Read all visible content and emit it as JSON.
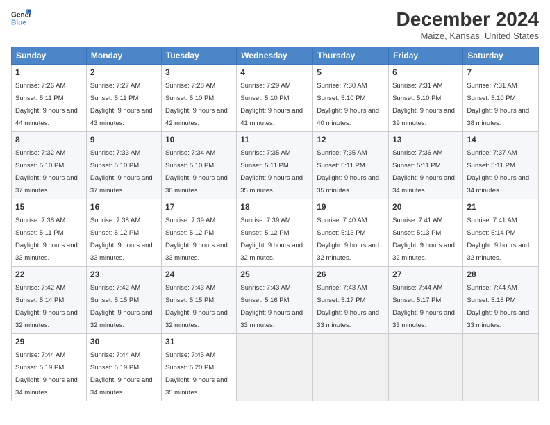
{
  "header": {
    "logo_line1": "General",
    "logo_line2": "Blue",
    "month": "December 2024",
    "location": "Maize, Kansas, United States"
  },
  "weekdays": [
    "Sunday",
    "Monday",
    "Tuesday",
    "Wednesday",
    "Thursday",
    "Friday",
    "Saturday"
  ],
  "weeks": [
    [
      {
        "day": "1",
        "sunrise": "Sunrise: 7:26 AM",
        "sunset": "Sunset: 5:11 PM",
        "daylight": "Daylight: 9 hours and 44 minutes."
      },
      {
        "day": "2",
        "sunrise": "Sunrise: 7:27 AM",
        "sunset": "Sunset: 5:11 PM",
        "daylight": "Daylight: 9 hours and 43 minutes."
      },
      {
        "day": "3",
        "sunrise": "Sunrise: 7:28 AM",
        "sunset": "Sunset: 5:10 PM",
        "daylight": "Daylight: 9 hours and 42 minutes."
      },
      {
        "day": "4",
        "sunrise": "Sunrise: 7:29 AM",
        "sunset": "Sunset: 5:10 PM",
        "daylight": "Daylight: 9 hours and 41 minutes."
      },
      {
        "day": "5",
        "sunrise": "Sunrise: 7:30 AM",
        "sunset": "Sunset: 5:10 PM",
        "daylight": "Daylight: 9 hours and 40 minutes."
      },
      {
        "day": "6",
        "sunrise": "Sunrise: 7:31 AM",
        "sunset": "Sunset: 5:10 PM",
        "daylight": "Daylight: 9 hours and 39 minutes."
      },
      {
        "day": "7",
        "sunrise": "Sunrise: 7:31 AM",
        "sunset": "Sunset: 5:10 PM",
        "daylight": "Daylight: 9 hours and 38 minutes."
      }
    ],
    [
      {
        "day": "8",
        "sunrise": "Sunrise: 7:32 AM",
        "sunset": "Sunset: 5:10 PM",
        "daylight": "Daylight: 9 hours and 37 minutes."
      },
      {
        "day": "9",
        "sunrise": "Sunrise: 7:33 AM",
        "sunset": "Sunset: 5:10 PM",
        "daylight": "Daylight: 9 hours and 37 minutes."
      },
      {
        "day": "10",
        "sunrise": "Sunrise: 7:34 AM",
        "sunset": "Sunset: 5:10 PM",
        "daylight": "Daylight: 9 hours and 36 minutes."
      },
      {
        "day": "11",
        "sunrise": "Sunrise: 7:35 AM",
        "sunset": "Sunset: 5:11 PM",
        "daylight": "Daylight: 9 hours and 35 minutes."
      },
      {
        "day": "12",
        "sunrise": "Sunrise: 7:35 AM",
        "sunset": "Sunset: 5:11 PM",
        "daylight": "Daylight: 9 hours and 35 minutes."
      },
      {
        "day": "13",
        "sunrise": "Sunrise: 7:36 AM",
        "sunset": "Sunset: 5:11 PM",
        "daylight": "Daylight: 9 hours and 34 minutes."
      },
      {
        "day": "14",
        "sunrise": "Sunrise: 7:37 AM",
        "sunset": "Sunset: 5:11 PM",
        "daylight": "Daylight: 9 hours and 34 minutes."
      }
    ],
    [
      {
        "day": "15",
        "sunrise": "Sunrise: 7:38 AM",
        "sunset": "Sunset: 5:11 PM",
        "daylight": "Daylight: 9 hours and 33 minutes."
      },
      {
        "day": "16",
        "sunrise": "Sunrise: 7:38 AM",
        "sunset": "Sunset: 5:12 PM",
        "daylight": "Daylight: 9 hours and 33 minutes."
      },
      {
        "day": "17",
        "sunrise": "Sunrise: 7:39 AM",
        "sunset": "Sunset: 5:12 PM",
        "daylight": "Daylight: 9 hours and 33 minutes."
      },
      {
        "day": "18",
        "sunrise": "Sunrise: 7:39 AM",
        "sunset": "Sunset: 5:12 PM",
        "daylight": "Daylight: 9 hours and 32 minutes."
      },
      {
        "day": "19",
        "sunrise": "Sunrise: 7:40 AM",
        "sunset": "Sunset: 5:13 PM",
        "daylight": "Daylight: 9 hours and 32 minutes."
      },
      {
        "day": "20",
        "sunrise": "Sunrise: 7:41 AM",
        "sunset": "Sunset: 5:13 PM",
        "daylight": "Daylight: 9 hours and 32 minutes."
      },
      {
        "day": "21",
        "sunrise": "Sunrise: 7:41 AM",
        "sunset": "Sunset: 5:14 PM",
        "daylight": "Daylight: 9 hours and 32 minutes."
      }
    ],
    [
      {
        "day": "22",
        "sunrise": "Sunrise: 7:42 AM",
        "sunset": "Sunset: 5:14 PM",
        "daylight": "Daylight: 9 hours and 32 minutes."
      },
      {
        "day": "23",
        "sunrise": "Sunrise: 7:42 AM",
        "sunset": "Sunset: 5:15 PM",
        "daylight": "Daylight: 9 hours and 32 minutes."
      },
      {
        "day": "24",
        "sunrise": "Sunrise: 7:43 AM",
        "sunset": "Sunset: 5:15 PM",
        "daylight": "Daylight: 9 hours and 32 minutes."
      },
      {
        "day": "25",
        "sunrise": "Sunrise: 7:43 AM",
        "sunset": "Sunset: 5:16 PM",
        "daylight": "Daylight: 9 hours and 33 minutes."
      },
      {
        "day": "26",
        "sunrise": "Sunrise: 7:43 AM",
        "sunset": "Sunset: 5:17 PM",
        "daylight": "Daylight: 9 hours and 33 minutes."
      },
      {
        "day": "27",
        "sunrise": "Sunrise: 7:44 AM",
        "sunset": "Sunset: 5:17 PM",
        "daylight": "Daylight: 9 hours and 33 minutes."
      },
      {
        "day": "28",
        "sunrise": "Sunrise: 7:44 AM",
        "sunset": "Sunset: 5:18 PM",
        "daylight": "Daylight: 9 hours and 33 minutes."
      }
    ],
    [
      {
        "day": "29",
        "sunrise": "Sunrise: 7:44 AM",
        "sunset": "Sunset: 5:19 PM",
        "daylight": "Daylight: 9 hours and 34 minutes."
      },
      {
        "day": "30",
        "sunrise": "Sunrise: 7:44 AM",
        "sunset": "Sunset: 5:19 PM",
        "daylight": "Daylight: 9 hours and 34 minutes."
      },
      {
        "day": "31",
        "sunrise": "Sunrise: 7:45 AM",
        "sunset": "Sunset: 5:20 PM",
        "daylight": "Daylight: 9 hours and 35 minutes."
      },
      null,
      null,
      null,
      null
    ]
  ]
}
